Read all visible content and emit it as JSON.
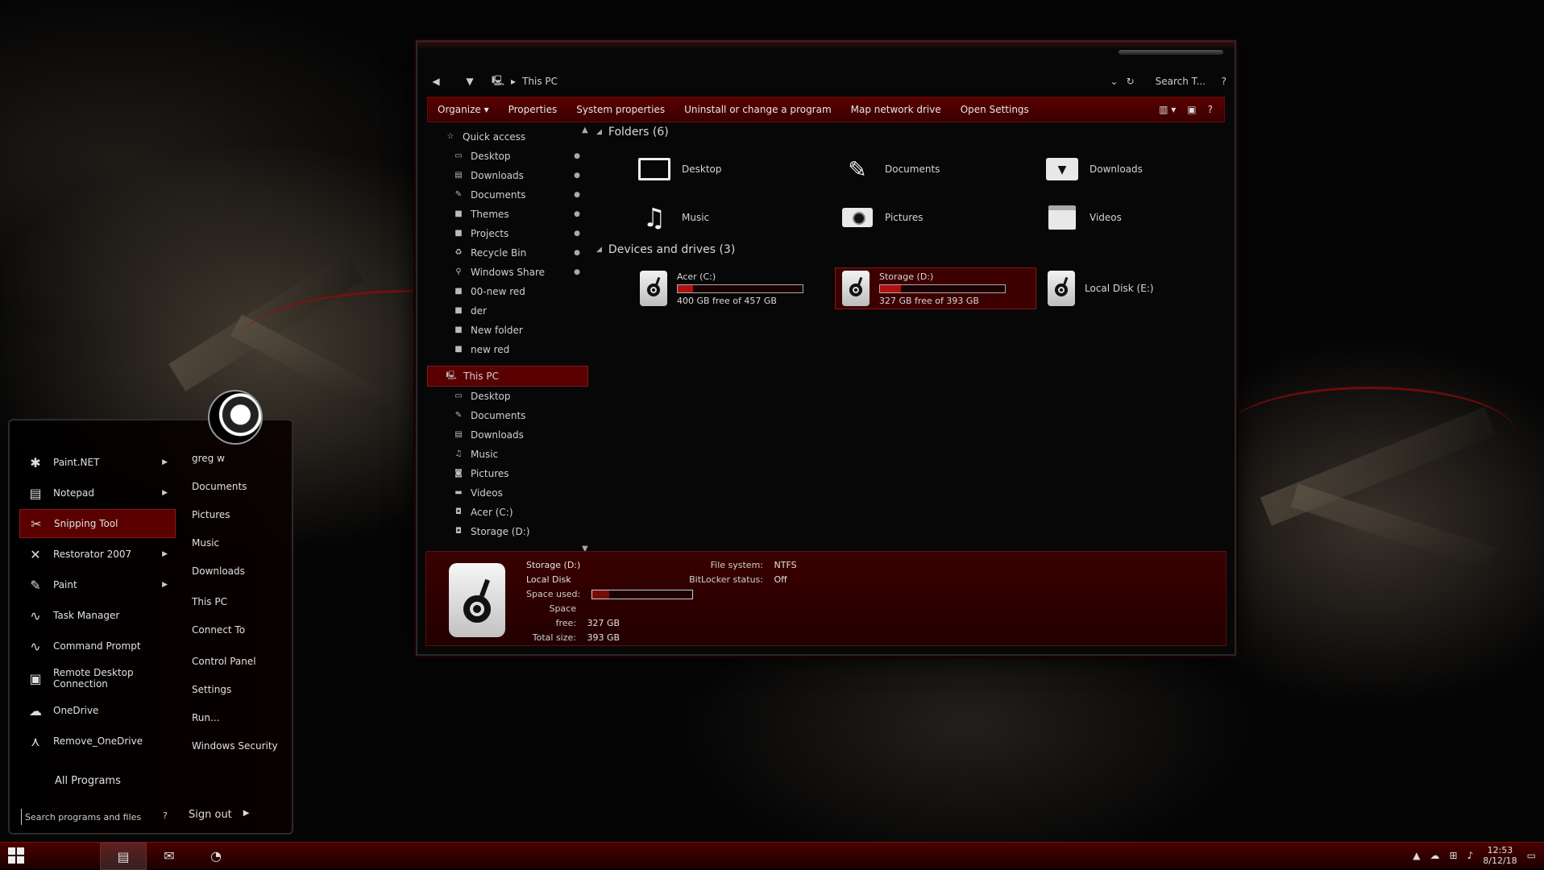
{
  "window": {
    "breadcrumb": "This PC",
    "search_placeholder": "Search T...",
    "help": "?",
    "toolbar": [
      "Organize ▾",
      "Properties",
      "System properties",
      "Uninstall or change a program",
      "Map network drive",
      "Open Settings"
    ]
  },
  "nav": {
    "quick_access": "Quick access",
    "quick_items": [
      "Desktop",
      "Downloads",
      "Documents",
      "Themes",
      "Projects",
      "Recycle Bin",
      "Windows Share",
      "00-new red",
      "der",
      "New folder",
      "new red"
    ],
    "this_pc": "This PC",
    "pc_items": [
      "Desktop",
      "Documents",
      "Downloads",
      "Music",
      "Pictures",
      "Videos",
      "Acer (C:)",
      "Storage (D:)"
    ]
  },
  "content": {
    "folders_header": "Folders (6)",
    "folders": [
      "Desktop",
      "Documents",
      "Downloads",
      "Music",
      "Pictures",
      "Videos"
    ],
    "devices_header": "Devices and drives (3)",
    "drives": [
      {
        "name": "Acer (C:)",
        "free": "400 GB free of 457 GB",
        "used_fraction": 0.12
      },
      {
        "name": "Storage (D:)",
        "free": "327 GB free of 393 GB",
        "used_fraction": 0.17
      },
      {
        "name": "Local Disk (E:)"
      }
    ]
  },
  "details": {
    "name": "Storage (D:)",
    "type": "Local Disk",
    "space_used_label": "Space used:",
    "space_free_label": "Space free:",
    "space_free": "327 GB",
    "total_label": "Total size:",
    "total": "393 GB",
    "fs_label": "File system:",
    "fs": "NTFS",
    "bitlocker_label": "BitLocker status:",
    "bitlocker": "Off",
    "used_fraction": 0.17
  },
  "start_menu": {
    "programs": [
      "Paint.NET",
      "Notepad",
      "Snipping Tool",
      "Restorator 2007",
      "Paint",
      "Task Manager",
      "Command Prompt",
      "Remote Desktop Connection",
      "OneDrive",
      "Remove_OneDrive"
    ],
    "right_links": [
      "greg w",
      "Documents",
      "Pictures",
      "Music",
      "Downloads",
      "This PC",
      "Connect To",
      "Control Panel",
      "Settings",
      "Run...",
      "Windows Security"
    ],
    "all_programs": "All Programs",
    "search_placeholder": "Search programs and files",
    "search_help": "?",
    "sign_out": "Sign out"
  },
  "taskbar": {
    "time": "12:53",
    "date": "8/12/18"
  },
  "colors": {
    "accent": "#5a0000",
    "accent_border": "#8a1414",
    "background": "#050505"
  }
}
